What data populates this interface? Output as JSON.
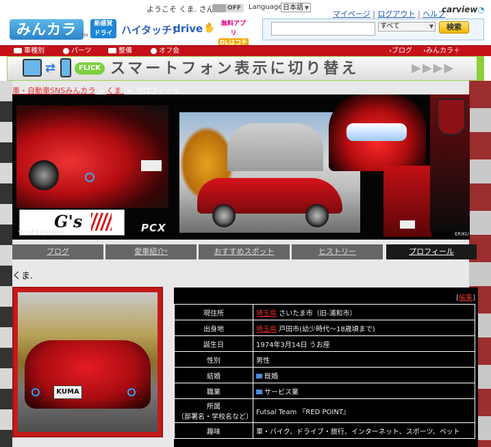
{
  "header": {
    "logo_text": "みんカラ",
    "logo_tm": "TM",
    "promo_new": "新感覚\nドライブ!",
    "promo_hightouch": "ハイタッチ!",
    "promo_drive": "drive",
    "promo_app_1": "無料アプリ",
    "promo_app_2": "DLはコチラ",
    "welcome": "ようこそ くま. さん",
    "toggle_label": "OFF",
    "language_label": "Language",
    "language_value": "日本語",
    "links": [
      "マイページ",
      "ログアウト",
      "ヘルプ"
    ],
    "carview_brand": "carview",
    "search": {
      "placeholder": "",
      "scope": "すべて",
      "button": "検索"
    }
  },
  "nav": {
    "items": [
      "車種別",
      "パーツ",
      "整備",
      "オフ会"
    ],
    "right_items": [
      "ブログ",
      "みんカラ＋"
    ]
  },
  "banner": {
    "flick": "FLICK",
    "text": "スマートフォン表示に切り替え",
    "chevrons": "▶▶▶▶"
  },
  "breadcrumb": {
    "items": [
      "車・自動車SNSみんカラ",
      "くま."
    ],
    "current": "プロフィール"
  },
  "collage": {
    "gs_logo": "G's",
    "gs_caption": "やっぱりG'sが好き",
    "pcx_logo": "PCX",
    "mark": "ERIKU"
  },
  "tabs": [
    {
      "label": "ブログ",
      "sup": ""
    },
    {
      "label": "愛車紹介",
      "sup": "*"
    },
    {
      "label": "おすすめスポット",
      "sup": ""
    },
    {
      "label": "ヒストリー",
      "sup": ""
    },
    {
      "label": "プロフィール",
      "sup": ""
    }
  ],
  "user": {
    "name": "くま.",
    "photo_plate": "KUMA"
  },
  "profile": {
    "edit_open": "[",
    "edit_label": "編集",
    "edit_close": "]",
    "rows": [
      {
        "key": "現住所",
        "link": "埼玉県",
        "value": " さいたま市（旧-浦和市）"
      },
      {
        "key": "出身地",
        "link": "埼玉県",
        "value": " 戸田市(幼少時代～18歳頃まで)"
      },
      {
        "key": "誕生日",
        "link": "",
        "value": "1974年3月14日 うお座"
      },
      {
        "key": "性別",
        "link": "",
        "value": "男性"
      },
      {
        "key": "結婚",
        "link": "",
        "value": "既婚"
      },
      {
        "key": "職業",
        "link": "",
        "value": "サービス業"
      },
      {
        "key": "所属",
        "key2": "（部署名・学校名など）",
        "link": "",
        "value": "Futsal Team 『RED POINT』"
      },
      {
        "key": "趣味",
        "link": "",
        "value": "車・バイク、ドライブ・旅行、インターネット、スポーツ、ペット"
      }
    ]
  }
}
